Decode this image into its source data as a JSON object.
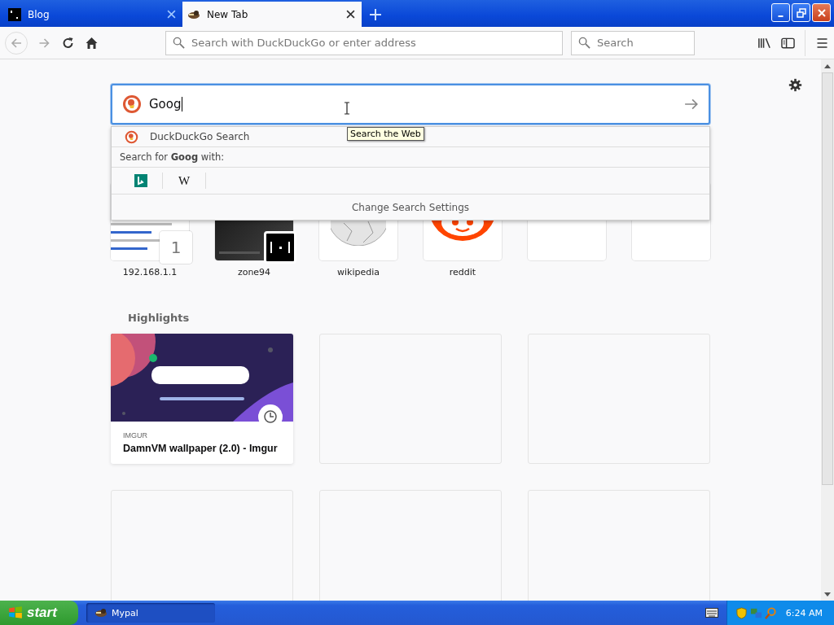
{
  "tabs": [
    {
      "title": "Blog",
      "selected": false
    },
    {
      "title": "New Tab",
      "selected": true
    }
  ],
  "toolbar": {
    "address_placeholder": "Search with DuckDuckGo or enter address",
    "search_placeholder": "Search"
  },
  "search": {
    "value": "Goog",
    "tooltip": "Search the Web",
    "engine": "DuckDuckGo Search",
    "search_for": "Search for **Goog** with:",
    "engines": [
      {
        "kind": "bing"
      },
      {
        "kind": "wikipedia",
        "label": "W"
      }
    ],
    "settings": "Change Search Settings"
  },
  "top_sites": [
    {
      "kind": "screenshot",
      "label": "192.168.1.1",
      "badge": "1"
    },
    {
      "kind": "pong",
      "label": "zone94"
    },
    {
      "kind": "wikipedia",
      "label": "wikipedia"
    },
    {
      "kind": "reddit",
      "label": "reddit"
    },
    {
      "kind": "empty"
    },
    {
      "kind": "empty"
    }
  ],
  "highlights": {
    "title": "Highlights",
    "cards": [
      {
        "kind": "page",
        "source": "IMGUR",
        "title": "DamnVM wallpaper (2.0) - Imgur"
      },
      {
        "kind": "empty"
      },
      {
        "kind": "empty"
      },
      {
        "kind": "empty"
      },
      {
        "kind": "empty"
      },
      {
        "kind": "empty"
      }
    ]
  },
  "taskbar": {
    "start": "start",
    "tasks": [
      {
        "label": "Mypal",
        "selected": true
      }
    ],
    "time": "6:24 AM"
  }
}
